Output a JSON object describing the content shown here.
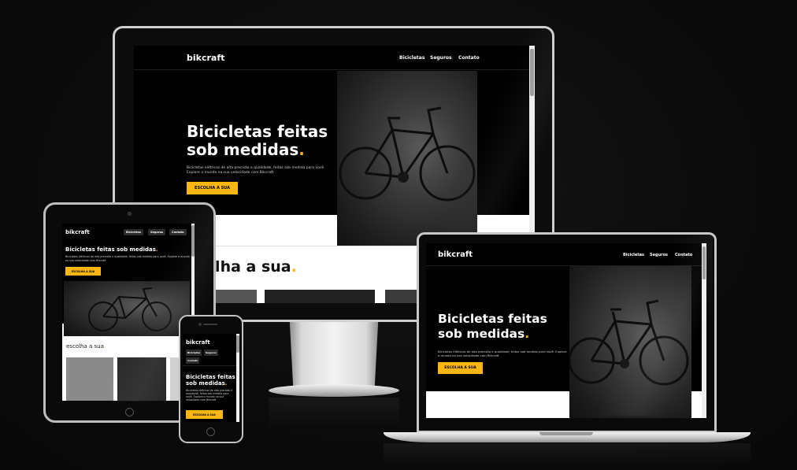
{
  "site": {
    "logo": "bikcraft",
    "nav": [
      "Bicicletas",
      "Seguros",
      "Contato"
    ],
    "hero_title_line1": "Bicicletas feitas",
    "hero_title_line2": "sob medidas",
    "hero_title_full": "Bicicletas feitas sob medidas",
    "hero_dot": ".",
    "hero_text": "Bicicletas elétricas de alta precisão e qualidade, feitas sob medida para você. Explore o mundo na sua velocidade com Bikcraft",
    "cta_label": "ESCOLHA A SUA",
    "section_title_monitor": "olha a sua",
    "section_title_tablet": "escolha a sua",
    "section_dot": "."
  },
  "colors": {
    "accent": "#fbb614",
    "background": "#0b0b0b",
    "site_bg": "#000000"
  },
  "devices": [
    "monitor",
    "tablet",
    "phone",
    "laptop"
  ]
}
